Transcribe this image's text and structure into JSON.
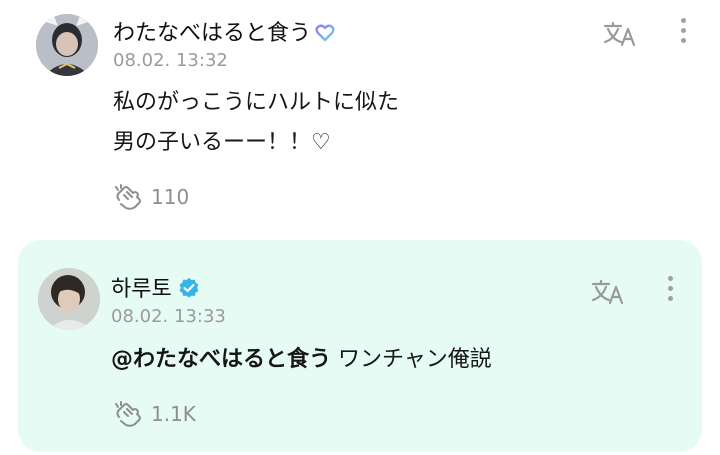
{
  "post": {
    "author_name": "わたなべはると食う",
    "timestamp": "08.02. 13:32",
    "body": "私のがっこうにハルトに似た男の子いるーー！！♡",
    "like_count": "110",
    "badge_icon": "heart-badge-icon"
  },
  "reply": {
    "author_name": "하루토",
    "timestamp": "08.02. 13:33",
    "mention": "@わたなべはると食う",
    "body": " ワンチャン俺説",
    "like_count": "1.1K",
    "badge_icon": "verified-check-icon",
    "card_color": "#e7fbf5"
  },
  "colors": {
    "badge_check": "#38b3e6",
    "heart_gradient_start": "#8f7cf0",
    "heart_gradient_end": "#6fd3e6",
    "muted_text": "#9b9b9b"
  }
}
